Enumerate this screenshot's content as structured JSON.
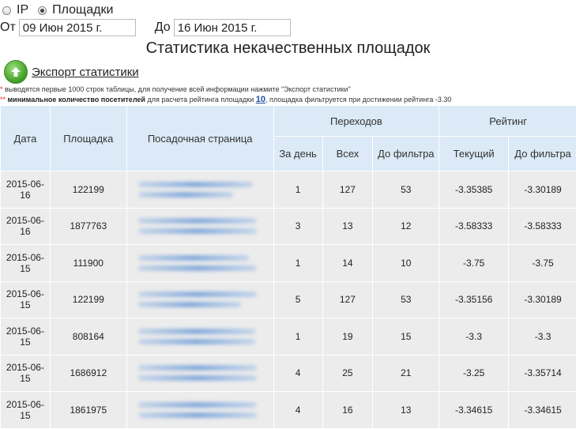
{
  "radios": [
    {
      "label": "IP",
      "checked": false
    },
    {
      "label": "Площадки",
      "checked": true
    }
  ],
  "dates": {
    "from_label": "От",
    "from_value": "09 Июн 2015 г.",
    "to_label": "До",
    "to_value": "16 Июн 2015 г."
  },
  "title": "Статистика некачественных площадок",
  "export_label": "Экспорт статистики",
  "notes": {
    "line1_star": "*",
    "line1": " выводятся первые 1000 строк таблицы, для получение всей информации нажмите \"Экспорт статистики\"",
    "line2_star": "**",
    "line2_bold": " минимальное количество посетителей",
    "line2_mid": " для расчета рейтинга площадки ",
    "line2_link": "10",
    "line2_end": ", площадка фильтруется при достижении рейтинга -3.30"
  },
  "table": {
    "headers": {
      "date": "Дата",
      "site": "Площадка",
      "landing": "Посадочная страница",
      "transitions": "Переходов",
      "per_day": "За день",
      "total": "Всех",
      "before_filter": "До фильтра",
      "rating": "Рейтинг",
      "current": "Текущий",
      "rating_before_filter": "До фильтра"
    },
    "rows": [
      {
        "date": "2015-06-16",
        "site": "122199",
        "per_day": "1",
        "total": "127",
        "before": "53",
        "current": "-3.35385",
        "rating_before": "-3.30189"
      },
      {
        "date": "2015-06-16",
        "site": "1877763",
        "per_day": "3",
        "total": "13",
        "before": "12",
        "current": "-3.58333",
        "rating_before": "-3.58333"
      },
      {
        "date": "2015-06-15",
        "site": "111900",
        "per_day": "1",
        "total": "14",
        "before": "10",
        "current": "-3.75",
        "rating_before": "-3.75"
      },
      {
        "date": "2015-06-15",
        "site": "122199",
        "per_day": "5",
        "total": "127",
        "before": "53",
        "current": "-3.35156",
        "rating_before": "-3.30189"
      },
      {
        "date": "2015-06-15",
        "site": "808164",
        "per_day": "1",
        "total": "19",
        "before": "15",
        "current": "-3.3",
        "rating_before": "-3.3"
      },
      {
        "date": "2015-06-15",
        "site": "1686912",
        "per_day": "4",
        "total": "25",
        "before": "21",
        "current": "-3.25",
        "rating_before": "-3.35714"
      },
      {
        "date": "2015-06-15",
        "site": "1861975",
        "per_day": "4",
        "total": "16",
        "before": "13",
        "current": "-3.34615",
        "rating_before": "-3.34615"
      }
    ]
  }
}
